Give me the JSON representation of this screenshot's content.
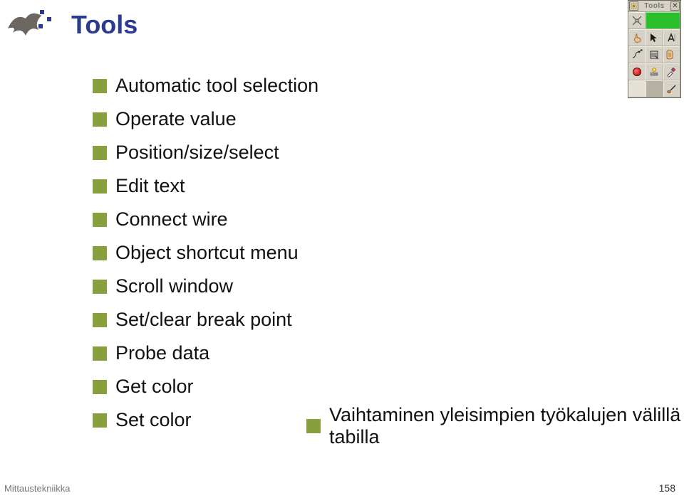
{
  "title": "Tools",
  "list": {
    "items": [
      "Automatic tool selection",
      "Operate value",
      "Position/size/select",
      "Edit text",
      "Connect wire",
      "Object shortcut menu",
      "Scroll window",
      "Set/clear break point",
      "Probe data",
      "Get color",
      "Set color"
    ]
  },
  "sublist": {
    "items": [
      "Vaihtaminen yleisimpien työkalujen välillä tabilla"
    ]
  },
  "footer": {
    "left": "Mittaustekniikka",
    "right": "158"
  },
  "palette": {
    "title": "Tools",
    "close": "✕",
    "cells": [
      {
        "name": "automatic-tool-icon"
      },
      {
        "name": "green-run-button"
      },
      {
        "name": "wand-icon"
      },
      {
        "name": "operate-finger-icon"
      },
      {
        "name": "arrow-cursor-icon"
      },
      {
        "name": "edit-text-icon"
      },
      {
        "name": "connect-wire-icon"
      },
      {
        "name": "shortcut-menu-icon"
      },
      {
        "name": "scroll-window-icon"
      },
      {
        "name": "breakpoint-icon"
      },
      {
        "name": "probe-data-icon"
      },
      {
        "name": "get-color-dropper-icon"
      },
      {
        "name": "color-swatch-a"
      },
      {
        "name": "color-swatch-b"
      },
      {
        "name": "set-color-brush-icon"
      }
    ]
  }
}
